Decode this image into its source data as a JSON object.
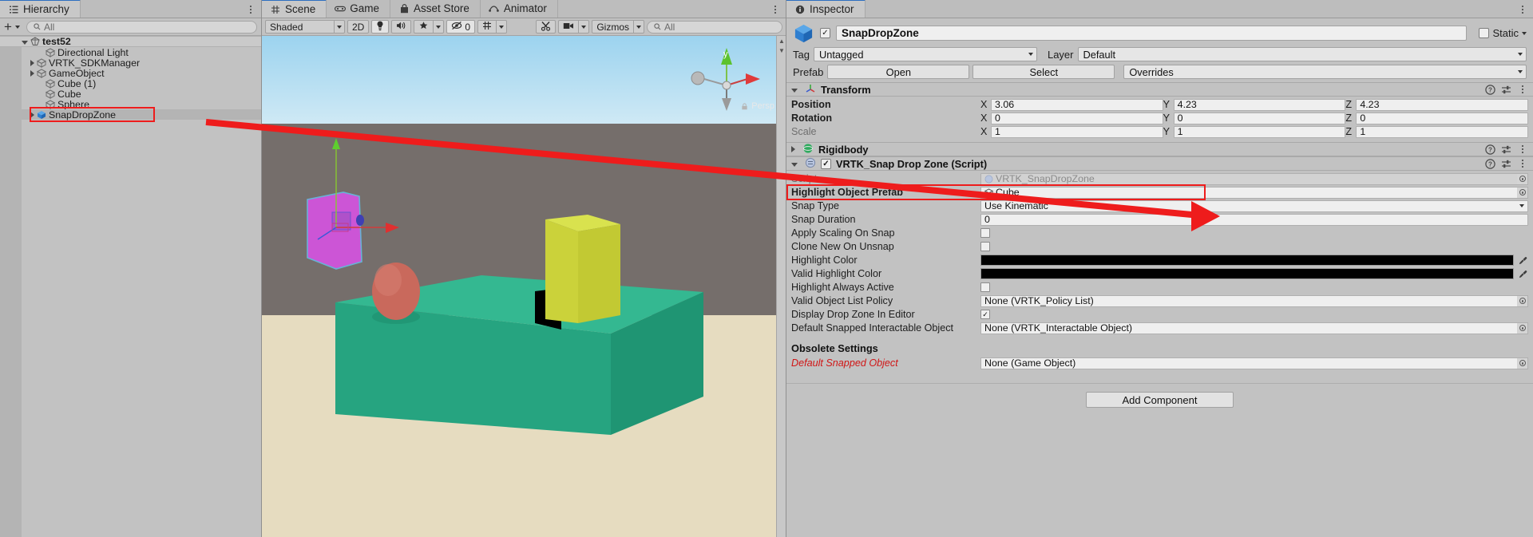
{
  "hierarchy": {
    "tab_label": "Hierarchy",
    "tab_icon": "hierarchy-icon",
    "create_label": "+",
    "search_placeholder": "All",
    "rows": [
      {
        "label": "test52",
        "indent": 0,
        "twisty": "open",
        "icon": "scene-icon",
        "scene": true
      },
      {
        "label": "Directional Light",
        "indent": 2,
        "twisty": "none",
        "icon": "gameobject-cube-icon"
      },
      {
        "label": "VRTK_SDKManager",
        "indent": 1,
        "twisty": "closed",
        "icon": "gameobject-cube-icon"
      },
      {
        "label": "GameObject",
        "indent": 1,
        "twisty": "closed",
        "icon": "gameobject-cube-icon"
      },
      {
        "label": "Cube (1)",
        "indent": 2,
        "twisty": "none",
        "icon": "gameobject-cube-icon"
      },
      {
        "label": "Cube",
        "indent": 2,
        "twisty": "none",
        "icon": "gameobject-cube-icon"
      },
      {
        "label": "Sphere",
        "indent": 2,
        "twisty": "none",
        "icon": "gameobject-cube-icon"
      },
      {
        "label": "SnapDropZone",
        "indent": 1,
        "twisty": "closed",
        "icon": "prefab-cube-icon",
        "selected": true,
        "highlighted": true
      }
    ]
  },
  "scene": {
    "tabs": [
      {
        "label": "Scene",
        "icon": "scene-grid-icon",
        "active": true
      },
      {
        "label": "Game",
        "icon": "game-pad-icon",
        "active": false
      },
      {
        "label": "Asset Store",
        "icon": "asset-store-icon",
        "active": false
      },
      {
        "label": "Animator",
        "icon": "animator-icon",
        "active": false
      }
    ],
    "toolbar": {
      "draw_mode": "Shaded",
      "two_d": "2D",
      "lighting_icon": "light-bulb-icon",
      "audio_icon": "audio-speaker-icon",
      "fx_icon": "effects-icon",
      "hidden_count": "0",
      "hidden_icon": "hidden-objects-icon",
      "grid_icon": "scene-grid-toggle-icon",
      "tools_icon": "component-tools-icon",
      "camera_icon": "scene-camera-icon",
      "gizmos_label": "Gizmos",
      "search_placeholder": "All"
    },
    "gizmo": {
      "axis_y_label": "y",
      "persp_label": "Persp",
      "lock_icon": "lock-icon"
    },
    "colors": {
      "sky_top": "#9cd3ef",
      "sky_bottom": "#cfe9f5",
      "wall": "#756e6b",
      "floor": "#e6dcc0",
      "table_cube": "#27a57f",
      "table_cube_top": "#34b891",
      "yellow_cube": "#cbd23a",
      "yellow_cube_top": "#d9e24e",
      "sphere": "#c9695c",
      "snapzone": "#cc55d6",
      "snapzone_outline": "#67b3d6",
      "highlight_red": "#ee1c1c"
    }
  },
  "inspector": {
    "tab_label": "Inspector",
    "tab_icon": "info-circle-icon",
    "object_name": "SnapDropZone",
    "object_enabled": true,
    "object_icon": "prefab-cube-icon",
    "static_label": "Static",
    "static_checked": false,
    "tag_label": "Tag",
    "tag_value": "Untagged",
    "layer_label": "Layer",
    "layer_value": "Default",
    "prefab_label": "Prefab",
    "prefab_open": "Open",
    "prefab_select": "Select",
    "prefab_overrides": "Overrides",
    "transform": {
      "title": "Transform",
      "icon": "transform-axis-icon",
      "rows": [
        {
          "label": "Position",
          "x": "3.06",
          "y": "4.23",
          "z": "4.23"
        },
        {
          "label": "Rotation",
          "x": "0",
          "y": "0",
          "z": "0"
        },
        {
          "label": "Scale",
          "x": "1",
          "y": "1",
          "z": "1",
          "dim": true
        }
      ],
      "axis_labels": [
        "X",
        "Y",
        "Z"
      ]
    },
    "rigidbody": {
      "title": "Rigidbody",
      "icon": "rigidbody-icon",
      "collapsed": true
    },
    "script": {
      "title": "VRTK_Snap Drop Zone (Script)",
      "icon": "script-icon",
      "enabled": true,
      "properties": [
        {
          "label": "Script",
          "type": "object",
          "value": "VRTK_SnapDropZone",
          "readonly": true,
          "icon": "cs-script-icon"
        },
        {
          "label": "Highlight Object Prefab",
          "type": "object",
          "value": "Cube",
          "icon": "gameobject-cube-icon",
          "bold": true,
          "highlighted": true
        },
        {
          "label": "Snap Type",
          "type": "dropdown",
          "value": "Use Kinematic"
        },
        {
          "label": "Snap Duration",
          "type": "text",
          "value": "0"
        },
        {
          "label": "Apply Scaling On Snap",
          "type": "checkbox",
          "value": false
        },
        {
          "label": "Clone New On Unsnap",
          "type": "checkbox",
          "value": false
        },
        {
          "label": "Highlight Color",
          "type": "color",
          "value": "#000000"
        },
        {
          "label": "Valid Highlight Color",
          "type": "color",
          "value": "#000000"
        },
        {
          "label": "Highlight Always Active",
          "type": "checkbox",
          "value": false
        },
        {
          "label": "Valid Object List Policy",
          "type": "object",
          "value": "None (VRTK_Policy List)"
        },
        {
          "label": "Display Drop Zone In Editor",
          "type": "checkbox",
          "value": true
        },
        {
          "label": "Default Snapped Interactable Object",
          "type": "object",
          "value": "None (VRTK_Interactable Object)"
        }
      ],
      "obsolete_section": "Obsolete Settings",
      "obsolete_properties": [
        {
          "label": "Default Snapped Object",
          "type": "object",
          "value": "None (Game Object)"
        }
      ]
    },
    "add_component_label": "Add Component"
  },
  "annotation": {
    "color": "#ee1c1c",
    "description": "red arrow from SnapDropZone hierarchy item to Highlight Object Prefab field"
  }
}
